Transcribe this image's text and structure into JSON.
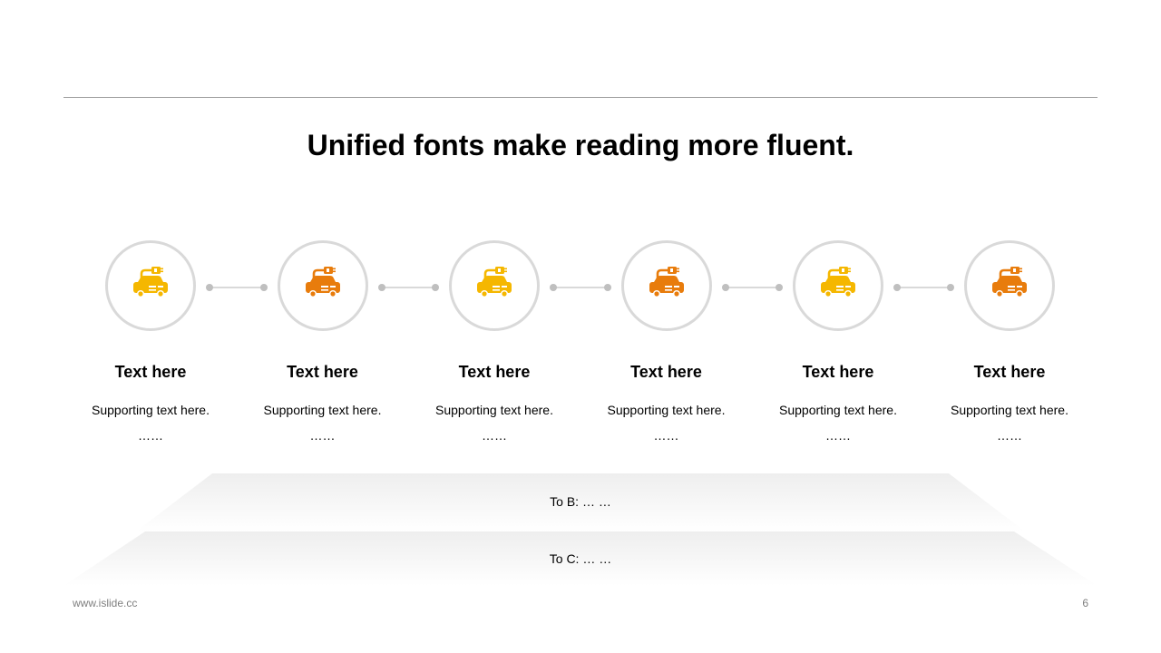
{
  "title": "Unified fonts make reading more fluent.",
  "colors": {
    "yellow": "#f5b700",
    "orange": "#e87c0c",
    "circle_border": "#d9d9d9"
  },
  "steps": [
    {
      "title": "Text here",
      "sub": "Supporting text here.",
      "dots": "……",
      "icon": "car-charging-icon",
      "color": "#f5b700"
    },
    {
      "title": "Text here",
      "sub": "Supporting text here.",
      "dots": "……",
      "icon": "car-charging-icon",
      "color": "#e87c0c"
    },
    {
      "title": "Text here",
      "sub": "Supporting text here.",
      "dots": "……",
      "icon": "car-charging-icon",
      "color": "#f5b700"
    },
    {
      "title": "Text here",
      "sub": "Supporting text here.",
      "dots": "……",
      "icon": "car-charging-icon",
      "color": "#e87c0c"
    },
    {
      "title": "Text here",
      "sub": "Supporting text here.",
      "dots": "……",
      "icon": "car-charging-icon",
      "color": "#f5b700"
    },
    {
      "title": "Text here",
      "sub": "Supporting text here.",
      "dots": "……",
      "icon": "car-charging-icon",
      "color": "#e87c0c"
    }
  ],
  "bands": {
    "b": "To B: … …",
    "c": "To C: … …"
  },
  "footer": {
    "site": "www.islide.cc",
    "page": "6"
  }
}
